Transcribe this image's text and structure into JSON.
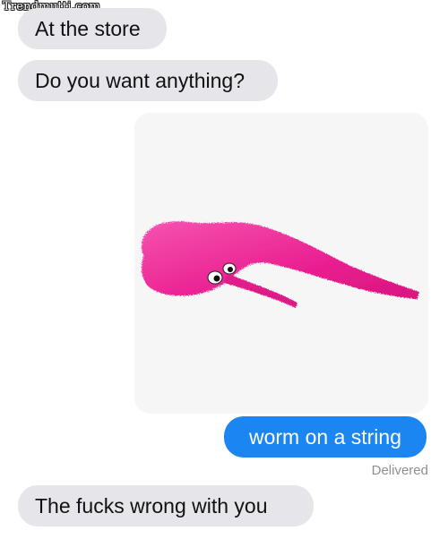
{
  "watermark": "Trendmutti.com",
  "messages": [
    {
      "direction": "incoming",
      "text": "At the store"
    },
    {
      "direction": "incoming",
      "text": "Do you want anything?"
    },
    {
      "direction": "incoming",
      "type": "image",
      "image_subject": "pink-fuzzy-worm-toy"
    },
    {
      "direction": "outgoing",
      "text": "worm on a string"
    },
    {
      "direction": "incoming",
      "text": "The fucks wrong with you"
    }
  ],
  "status": {
    "delivered": "Delivered"
  },
  "colors": {
    "incoming_bubble": "#e6e6ea",
    "outgoing_bubble": "#1b86f2",
    "worm": "#f0289a"
  }
}
